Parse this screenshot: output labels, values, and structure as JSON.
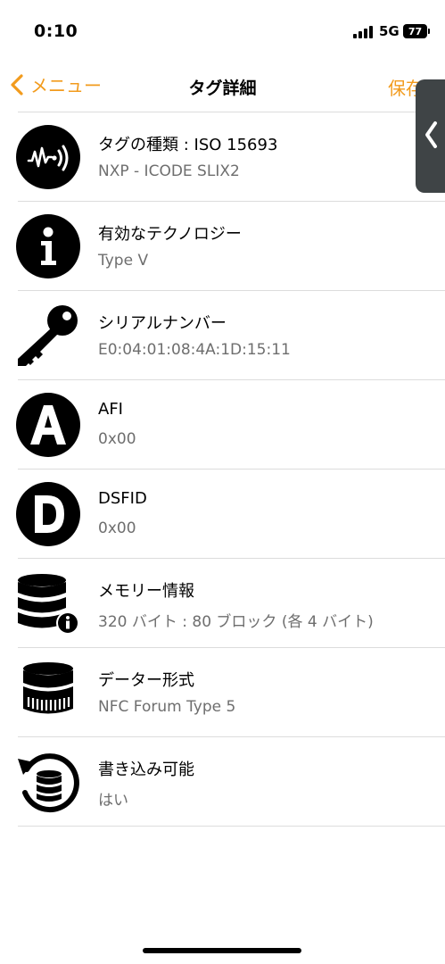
{
  "status_bar": {
    "time": "0:10",
    "network": "5G",
    "battery": "77"
  },
  "nav": {
    "back_label": "メニュー",
    "title": "タグ詳細",
    "save_label": "保存"
  },
  "rows": [
    {
      "icon": "nfc-tag-icon",
      "title": "タグの種類 : ISO 15693",
      "value": "NXP - ICODE SLIX2"
    },
    {
      "icon": "info-icon",
      "title": "有効なテクノロジー",
      "value": "Type V"
    },
    {
      "icon": "key-icon",
      "title": "シリアルナンバー",
      "value": "E0:04:01:08:4A:1D:15:11"
    },
    {
      "icon": "letter-a-icon",
      "title": "AFI",
      "value": "0x00"
    },
    {
      "icon": "letter-d-icon",
      "title": "DSFID",
      "value": "0x00"
    },
    {
      "icon": "database-info-icon",
      "title": "メモリー情報",
      "value": "320 バイト : 80 ブロック (各 4 バイト)"
    },
    {
      "icon": "database-format-icon",
      "title": "データー形式",
      "value": "NFC Forum Type 5"
    },
    {
      "icon": "database-refresh-icon",
      "title": "書き込み可能",
      "value": "はい"
    }
  ],
  "colors": {
    "accent": "#f29b1d",
    "side_handle": "#3f4446",
    "secondary_text": "#6e6e6e"
  }
}
